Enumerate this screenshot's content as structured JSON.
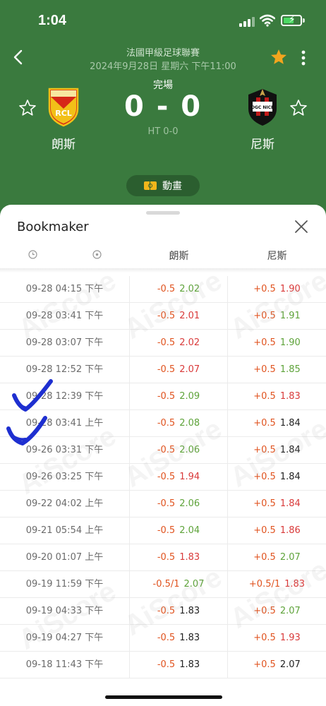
{
  "status_bar": {
    "time": "1:04"
  },
  "header": {
    "league": "法國甲級足球聯賽",
    "date": "2024年9月28日 星期六 下午11:00",
    "match_status": "完場",
    "score": "0 - 0",
    "ht_score": "HT 0-0",
    "home_team": "朗斯",
    "away_team": "尼斯",
    "animation_label": "動畫",
    "home_logo_text": "RCL",
    "away_logo_text": "OGC NICE"
  },
  "sheet": {
    "title": "Bookmaker",
    "columns": {
      "home": "朗斯",
      "away": "尼斯"
    }
  },
  "watermark_text": "AiScore",
  "colors": {
    "header_bg": "#3a7a3e",
    "handicap": "#e0531f",
    "odd_up": "#d93a3a",
    "odd_down": "#5ea33a",
    "odd_flat": "#222222",
    "annotation": "#1e2fd0"
  },
  "rows": [
    {
      "time": "09-28 04:15 下午",
      "home_hcp": "-0.5",
      "home_odd": "2.02",
      "home_dir": "down",
      "away_hcp": "+0.5",
      "away_odd": "1.90",
      "away_dir": "up"
    },
    {
      "time": "09-28 03:41 下午",
      "home_hcp": "-0.5",
      "home_odd": "2.01",
      "home_dir": "up",
      "away_hcp": "+0.5",
      "away_odd": "1.91",
      "away_dir": "down"
    },
    {
      "time": "09-28 03:07 下午",
      "home_hcp": "-0.5",
      "home_odd": "2.02",
      "home_dir": "up",
      "away_hcp": "+0.5",
      "away_odd": "1.90",
      "away_dir": "down"
    },
    {
      "time": "09-28 12:52 下午",
      "home_hcp": "-0.5",
      "home_odd": "2.07",
      "home_dir": "up",
      "away_hcp": "+0.5",
      "away_odd": "1.85",
      "away_dir": "down"
    },
    {
      "time": "09-28 12:39 下午",
      "home_hcp": "-0.5",
      "home_odd": "2.09",
      "home_dir": "down",
      "away_hcp": "+0.5",
      "away_odd": "1.83",
      "away_dir": "up"
    },
    {
      "time": "09-28 03:41 上午",
      "home_hcp": "-0.5",
      "home_odd": "2.08",
      "home_dir": "down",
      "away_hcp": "+0.5",
      "away_odd": "1.84",
      "away_dir": "flat"
    },
    {
      "time": "09-26 03:31 下午",
      "home_hcp": "-0.5",
      "home_odd": "2.06",
      "home_dir": "down",
      "away_hcp": "+0.5",
      "away_odd": "1.84",
      "away_dir": "flat"
    },
    {
      "time": "09-26 03:25 下午",
      "home_hcp": "-0.5",
      "home_odd": "1.94",
      "home_dir": "up",
      "away_hcp": "+0.5",
      "away_odd": "1.84",
      "away_dir": "flat"
    },
    {
      "time": "09-22 04:02 上午",
      "home_hcp": "-0.5",
      "home_odd": "2.06",
      "home_dir": "down",
      "away_hcp": "+0.5",
      "away_odd": "1.84",
      "away_dir": "up"
    },
    {
      "time": "09-21 05:54 上午",
      "home_hcp": "-0.5",
      "home_odd": "2.04",
      "home_dir": "down",
      "away_hcp": "+0.5",
      "away_odd": "1.86",
      "away_dir": "up"
    },
    {
      "time": "09-20 01:07 上午",
      "home_hcp": "-0.5",
      "home_odd": "1.83",
      "home_dir": "up",
      "away_hcp": "+0.5",
      "away_odd": "2.07",
      "away_dir": "down"
    },
    {
      "time": "09-19 11:59 下午",
      "home_hcp": "-0.5/1",
      "home_odd": "2.07",
      "home_dir": "down",
      "away_hcp": "+0.5/1",
      "away_odd": "1.83",
      "away_dir": "up"
    },
    {
      "time": "09-19 04:33 下午",
      "home_hcp": "-0.5",
      "home_odd": "1.83",
      "home_dir": "flat",
      "away_hcp": "+0.5",
      "away_odd": "2.07",
      "away_dir": "down"
    },
    {
      "time": "09-19 04:27 下午",
      "home_hcp": "-0.5",
      "home_odd": "1.83",
      "home_dir": "flat",
      "away_hcp": "+0.5",
      "away_odd": "1.93",
      "away_dir": "up"
    },
    {
      "time": "09-18 11:43 下午",
      "home_hcp": "-0.5",
      "home_odd": "1.83",
      "home_dir": "flat",
      "away_hcp": "+0.5",
      "away_odd": "2.07",
      "away_dir": "flat"
    }
  ]
}
